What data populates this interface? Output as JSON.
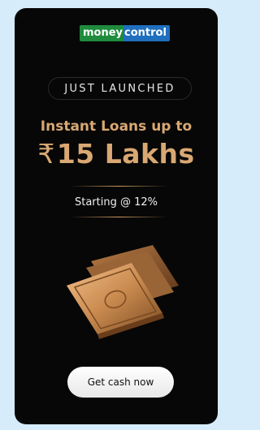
{
  "brand": {
    "logo_part1": "money",
    "logo_part2": "control"
  },
  "badge": {
    "label": "JUST LAUNCHED"
  },
  "headline": "Instant Loans up to",
  "amount": {
    "currency_symbol": "₹",
    "value": "15 Lakhs"
  },
  "rate_text": "Starting @ 12%",
  "cta": {
    "label": "Get cash now"
  },
  "icons": {
    "illustration": "cash-bundle-icon"
  },
  "colors": {
    "page_bg": "#d6ecfa",
    "card_bg": "#070707",
    "accent_gold": "#d9a873",
    "logo_green": "#1f8b3c",
    "logo_blue": "#1f6fbe",
    "button_bg": "#ffffff"
  }
}
